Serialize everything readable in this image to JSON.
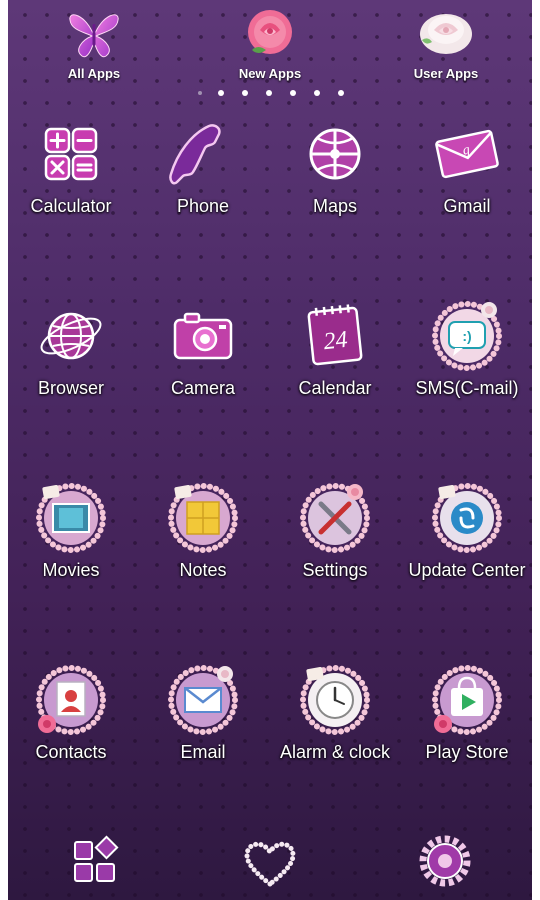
{
  "top_bar": {
    "items": [
      {
        "label": "All Apps",
        "icon": "butterfly-icon"
      },
      {
        "label": "New Apps",
        "icon": "pink-rose-icon"
      },
      {
        "label": "User Apps",
        "icon": "white-rose-icon"
      }
    ],
    "page_indicator": {
      "total": 7,
      "current": 1
    }
  },
  "apps": [
    {
      "label": "Calculator",
      "icon": "calculator-icon"
    },
    {
      "label": "Phone",
      "icon": "phone-handset-icon"
    },
    {
      "label": "Maps",
      "icon": "map-pin-icon"
    },
    {
      "label": "Gmail",
      "icon": "envelope-icon"
    },
    {
      "label": "Browser",
      "icon": "globe-icon"
    },
    {
      "label": "Camera",
      "icon": "camera-icon"
    },
    {
      "label": "Calendar",
      "icon": "calendar-icon",
      "calendar_day": "24"
    },
    {
      "label": "SMS(C-mail)",
      "icon": "chat-bubble-icon"
    },
    {
      "label": "Movies",
      "icon": "film-icon"
    },
    {
      "label": "Notes",
      "icon": "sticky-notes-icon"
    },
    {
      "label": "Settings",
      "icon": "tools-icon"
    },
    {
      "label": "Update Center",
      "icon": "update-arrows-icon"
    },
    {
      "label": "Contacts",
      "icon": "contact-card-icon"
    },
    {
      "label": "Email",
      "icon": "mail-envelope-icon"
    },
    {
      "label": "Alarm & clock",
      "icon": "clock-icon"
    },
    {
      "label": "Play Store",
      "icon": "shopping-bag-icon"
    }
  ],
  "dock": [
    {
      "name": "app-drawer",
      "icon": "app-grid-icon"
    },
    {
      "name": "heart",
      "icon": "pearl-heart-icon"
    },
    {
      "name": "settings",
      "icon": "gear-icon"
    }
  ],
  "colors": {
    "background": "#4a2660",
    "accent": "#e060c0",
    "pearl": "#f2c6d8",
    "label": "#ffffff"
  }
}
